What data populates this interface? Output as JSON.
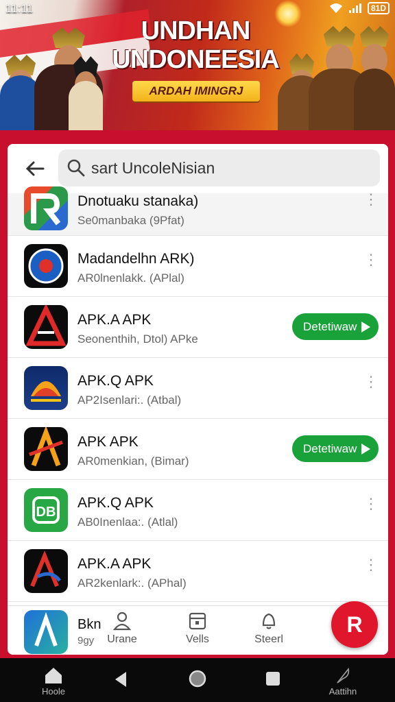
{
  "status": {
    "time": "11:11",
    "battery": "81D"
  },
  "banner": {
    "title": "UNDHAN UNDONEESIA",
    "subtitle": "ARDAH IMINGRJ"
  },
  "search": {
    "query": "sart UncoleNisian"
  },
  "apps": [
    {
      "name": "Dnotuaku stanaka)",
      "sub": "Se0manbaka (9Pfat)",
      "action": "menu"
    },
    {
      "name": "Madandelhn ARK)",
      "sub": "AR0lnenlakk. (APlal)",
      "action": "menu"
    },
    {
      "name": "APK.A APK",
      "sub": "Seonenthih, Dtol)  APke",
      "action": "download",
      "button": "Detetiwaw"
    },
    {
      "name": "APK.Q APK",
      "sub": "AP2Isenlari:. (Atbal)",
      "action": "menu"
    },
    {
      "name": "APK APK",
      "sub": "AR0menkian, (Bimar)",
      "action": "download",
      "button": "Detetiwaw"
    },
    {
      "name": "APK.Q APK",
      "sub": "AB0Inenlaa:. (Atlal)",
      "action": "menu"
    },
    {
      "name": "APK.A APK",
      "sub": "AR2kenlark:. (APhal)",
      "action": "menu"
    }
  ],
  "partial_app": {
    "name": "Bkn",
    "sub": "9gy"
  },
  "tabs": [
    {
      "label": "Urane",
      "icon": "profile-icon"
    },
    {
      "label": "Vells",
      "icon": "calendar-icon"
    },
    {
      "label": "Steerl",
      "icon": "bell-icon"
    }
  ],
  "fab": {
    "label": "R"
  },
  "nav": {
    "home": "Hoole",
    "extra": "Aattihn"
  },
  "colors": {
    "accent_red": "#c8102e",
    "download_green": "#1aa23a",
    "fab_red": "#e0172c"
  }
}
